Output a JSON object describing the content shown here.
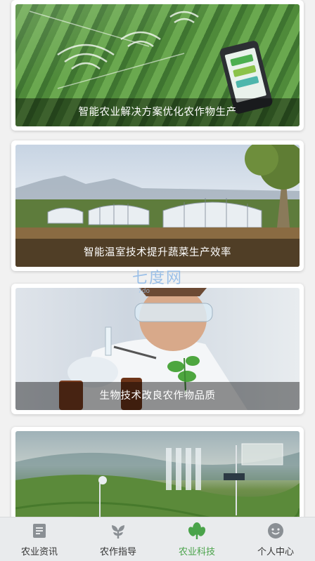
{
  "feed": {
    "cards": [
      {
        "caption": "智能农业解决方案优化农作物生产"
      },
      {
        "caption": "智能温室技术提升蔬菜生产效率"
      },
      {
        "caption": "生物技术改良农作物品质"
      },
      {
        "caption": ""
      }
    ]
  },
  "watermark": {
    "text": "七度网",
    "sub": "7do"
  },
  "tabbar": {
    "active": "农业科技",
    "accent_color": "#4aa34a",
    "inactive_color": "#8a8f94",
    "tabs": [
      {
        "label": "农业资讯",
        "icon": "newspaper-icon"
      },
      {
        "label": "农作指导",
        "icon": "sprout-icon"
      },
      {
        "label": "农业科技",
        "icon": "leaf-icon"
      },
      {
        "label": "个人中心",
        "icon": "smiley-face-icon"
      }
    ]
  }
}
